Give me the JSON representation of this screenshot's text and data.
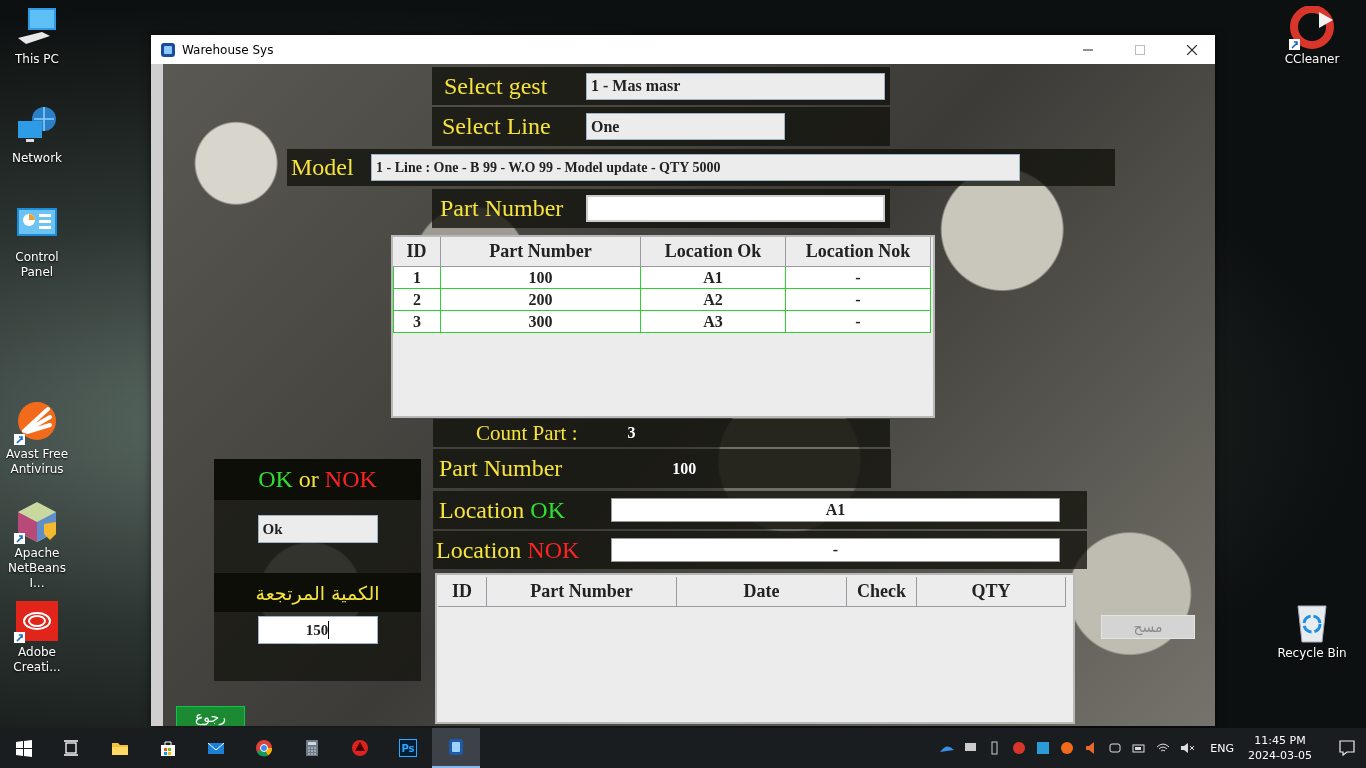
{
  "desktop_icons_left": [
    {
      "kind": "pc",
      "label": "This PC",
      "shortcut": false
    },
    {
      "kind": "network",
      "label": "Network",
      "shortcut": false
    },
    {
      "kind": "control",
      "label": "Control Panel",
      "shortcut": false
    },
    {
      "kind": "avast",
      "label": "Avast Free Antivirus",
      "shortcut": true
    },
    {
      "kind": "netbeans",
      "label": "Apache NetBeans I...",
      "shortcut": true
    },
    {
      "kind": "adobe",
      "label": "Adobe Creati...",
      "shortcut": true
    }
  ],
  "desktop_icons_right": [
    {
      "kind": "ccleaner",
      "label": "CCleaner",
      "shortcut": true
    },
    {
      "kind": "recycle",
      "label": "Recycle Bin",
      "shortcut": false
    }
  ],
  "window": {
    "title": "Warehouse Sys"
  },
  "form": {
    "gest": {
      "label": "Select gest",
      "value": "1 - Mas masr"
    },
    "line": {
      "label": "Select Line",
      "value": "One"
    },
    "model": {
      "label": "Model",
      "value": "1 - Line : One - B 99 - W.O 99 - Model update - QTY 5000"
    },
    "part_number": {
      "label": "Part Number"
    }
  },
  "parts_table": {
    "columns": [
      "ID",
      "Part Number",
      "Location Ok",
      "Location Nok"
    ],
    "rows": [
      [
        "1",
        "100",
        "A1",
        "-"
      ],
      [
        "2",
        "200",
        "A2",
        "-"
      ],
      [
        "3",
        "300",
        "A3",
        "-"
      ]
    ]
  },
  "count": {
    "label": "Count Part :",
    "value": "3"
  },
  "current_part": {
    "label": "Part Number",
    "value": "100"
  },
  "location_ok": {
    "label": [
      {
        "text": "Location",
        "kind": "plain"
      },
      {
        "text": "OK",
        "kind": "ok"
      }
    ],
    "value": "A1"
  },
  "location_nok": {
    "label": [
      {
        "text": "Location",
        "kind": "plain"
      },
      {
        "text": "NOK",
        "kind": "nok"
      }
    ],
    "value": "-"
  },
  "status_panel": {
    "title": [
      {
        "text": "OK",
        "kind": "ok"
      },
      {
        "text": "or",
        "kind": "plain"
      },
      {
        "text": "NOK",
        "kind": "nok"
      }
    ],
    "value": "Ok"
  },
  "qty_panel": {
    "title": "الكمية المرتجعة",
    "value": "150"
  },
  "history_table": {
    "columns": [
      "ID",
      "Part Number",
      "Date",
      "Check",
      "QTY"
    ]
  },
  "buttons": [
    {
      "label": "رجوع",
      "disabled": false
    },
    {
      "label": "مسح",
      "disabled": true
    }
  ],
  "taskbar": {
    "apps": [
      {
        "kind": "start",
        "selected": false
      },
      {
        "kind": "taskview",
        "selected": false
      },
      {
        "kind": "explorer",
        "selected": false
      },
      {
        "kind": "store",
        "selected": false
      },
      {
        "kind": "mail",
        "selected": false
      },
      {
        "kind": "chrome",
        "selected": false
      },
      {
        "kind": "calculator",
        "selected": false
      },
      {
        "kind": "redapp",
        "selected": false
      },
      {
        "kind": "photoshop",
        "label": "Ps",
        "selected": false
      },
      {
        "kind": "warehouse",
        "selected": true
      }
    ],
    "language": "ENG",
    "time": "11:45 PM",
    "date": "2024-03-05"
  }
}
